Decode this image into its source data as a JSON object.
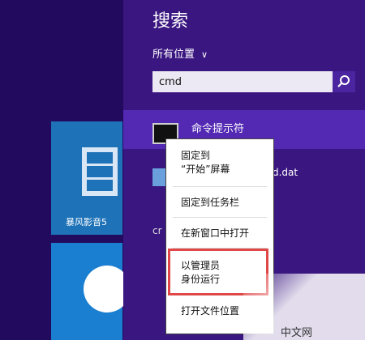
{
  "search": {
    "title": "搜索",
    "scope": "所有位置",
    "query": "cmd"
  },
  "results": [
    {
      "name": "命令提示符"
    },
    {
      "name": "d.dat"
    },
    {
      "name": "cr"
    }
  ],
  "context_menu": {
    "pin_start_line1": "固定到",
    "pin_start_line2": "“开始”屏幕",
    "pin_taskbar": "固定到任务栏",
    "open_new_window": "在新窗口中打开",
    "run_admin_line1": "以管理员",
    "run_admin_line2": "身份运行",
    "open_file_location": "打开文件位置"
  },
  "tiles": [
    {
      "name": "暴风影音5"
    },
    {
      "name": ""
    }
  ],
  "highlight_color": "#e04848",
  "watermark": "中文网"
}
